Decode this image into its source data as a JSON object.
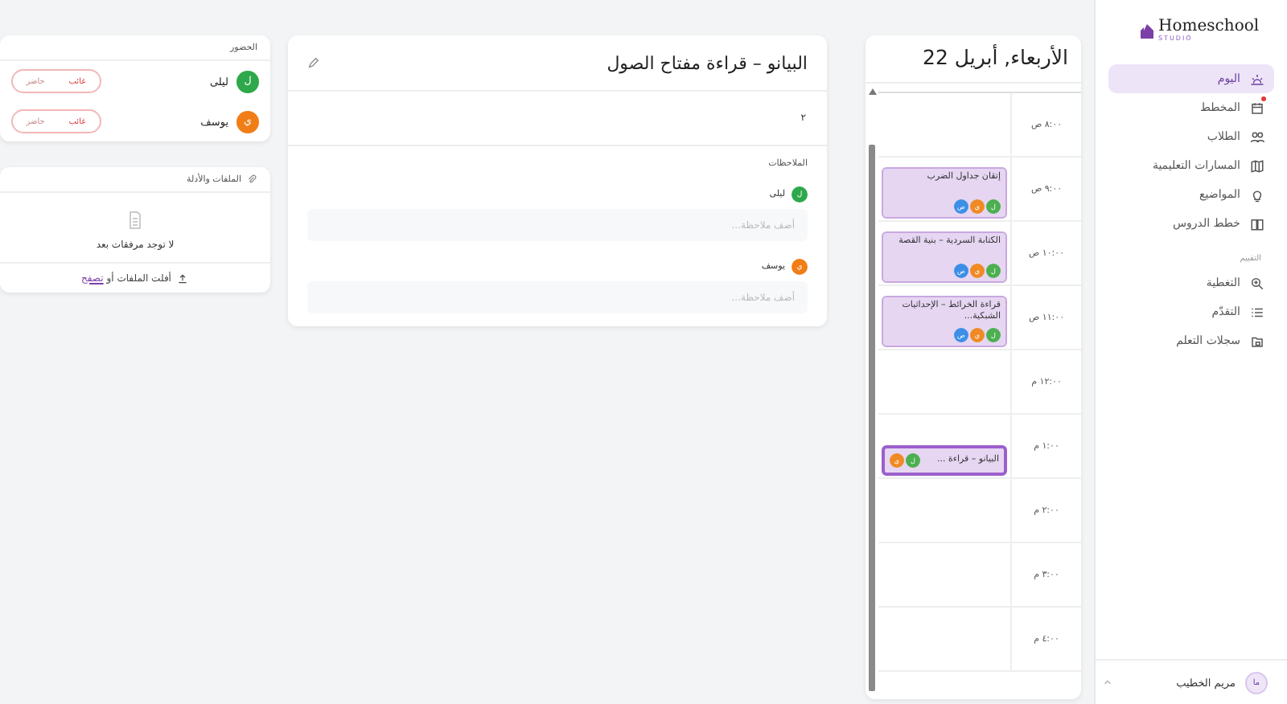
{
  "sidebar": {
    "brand": "Homeschool",
    "brand_sub": "STUDIO",
    "items": [
      {
        "label": "اليوم",
        "selected": true,
        "badge": false
      },
      {
        "label": "المخطط",
        "selected": false,
        "badge": true
      },
      {
        "label": "الطلاب",
        "selected": false,
        "badge": false
      },
      {
        "label": "المسارات التعليمية",
        "selected": false,
        "badge": false
      },
      {
        "label": "المواضيع",
        "selected": false,
        "badge": false
      },
      {
        "label": "خطط الدروس",
        "selected": false,
        "badge": false
      }
    ],
    "section": "التقييم",
    "section_items": [
      {
        "label": "التغطية",
        "selected": false,
        "badge": false
      },
      {
        "label": "التقدّم",
        "selected": false,
        "badge": false
      },
      {
        "label": "سجلات التعلم",
        "selected": false,
        "badge": false
      }
    ],
    "user": {
      "initials": "ما",
      "name": "مريم الخطيب"
    }
  },
  "calendar": {
    "title": "الأربعاء, أبريل 22",
    "rows": [
      {
        "time": "٨:٠٠ ص"
      },
      {
        "time": "٩:٠٠ ص",
        "event": {
          "title": "إتقان جداول الضرب",
          "selected": false,
          "students": [
            {
              "initial": "ل",
              "color": "#4caf50"
            },
            {
              "initial": "ي",
              "color": "#f08a24"
            },
            {
              "initial": "ص",
              "color": "#3d8fe6"
            }
          ]
        }
      },
      {
        "time": "١٠:٠٠ ص",
        "event": {
          "title": "الكتابة السردية – بنية القصة",
          "selected": false,
          "students": [
            {
              "initial": "ل",
              "color": "#4caf50"
            },
            {
              "initial": "ي",
              "color": "#f08a24"
            },
            {
              "initial": "ص",
              "color": "#3d8fe6"
            }
          ]
        }
      },
      {
        "time": "١١:٠٠ ص",
        "event": {
          "title": "قراءة الخرائط – الإحداثيات الشبكية...",
          "selected": false,
          "students": [
            {
              "initial": "ل",
              "color": "#4caf50"
            },
            {
              "initial": "ي",
              "color": "#f08a24"
            },
            {
              "initial": "ص",
              "color": "#3d8fe6"
            }
          ]
        }
      },
      {
        "time": "١٢:٠٠ م"
      },
      {
        "time": "١:٠٠ م",
        "event": {
          "title": "البيانو – قراءة ...",
          "selected": true,
          "students": [
            {
              "initial": "ل",
              "color": "#4caf50"
            },
            {
              "initial": "ي",
              "color": "#f08a24"
            }
          ]
        }
      },
      {
        "time": "٢:٠٠ م"
      },
      {
        "time": "٣:٠٠ م"
      },
      {
        "time": "٤:٠٠ م"
      }
    ]
  },
  "lesson": {
    "title": "البيانو – قراءة مفتاح الصول",
    "count": "٢",
    "notes_label": "الملاحظات",
    "notes": [
      {
        "name": "ليلى",
        "initial": "ل",
        "color": "#2ea84a",
        "placeholder": "أضف ملاحظة..."
      },
      {
        "name": "يوسف",
        "initial": "ي",
        "color": "#f07d16",
        "placeholder": "أضف ملاحظة..."
      }
    ]
  },
  "attendance": {
    "title": "الحضور",
    "students": [
      {
        "name": "ليلى",
        "initial": "ل",
        "color": "#2ea84a",
        "options": [
          {
            "label": "غائب",
            "selected": true
          },
          {
            "label": "حاضر",
            "selected": false
          }
        ]
      },
      {
        "name": "يوسف",
        "initial": "ي",
        "color": "#f07d16",
        "options": [
          {
            "label": "غائب",
            "selected": true
          },
          {
            "label": "حاضر",
            "selected": false
          }
        ]
      }
    ]
  },
  "files": {
    "title": "الملفات والأدلة",
    "empty": "لا توجد مرفقات بعد",
    "drop": "أفلت الملفات أو",
    "browse": "تصفح"
  }
}
